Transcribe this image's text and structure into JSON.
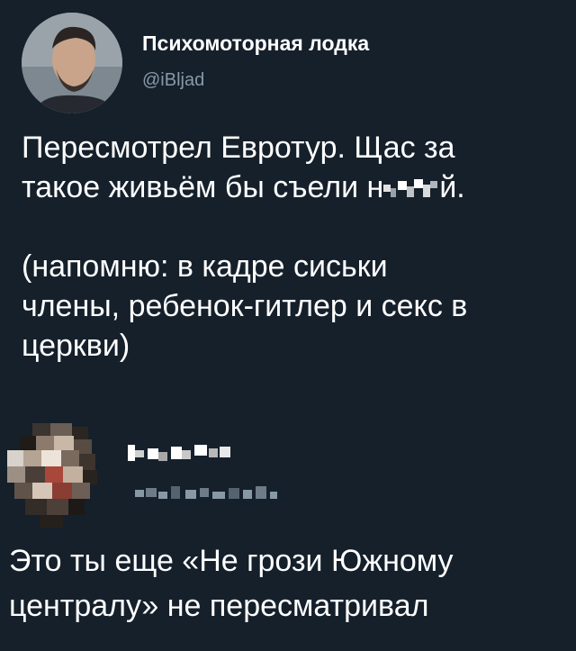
{
  "tweet": {
    "author_name": "Психомоторная лодка",
    "author_handle": "@iBljad",
    "line1": "Пересмотрел Евротур. Щас за",
    "line2_start": "такое живьём бы съели н",
    "line2_end": "й.",
    "line3": "(напомню: в кадре сиськи",
    "line4": "члены, ребенок-гитлер и секс в",
    "line5": "церкви)"
  },
  "reply": {
    "line1": "Это ты еще «Не грози Южному",
    "line2": "централу» не пересматривал"
  },
  "colors": {
    "background": "#15202b",
    "text": "#ffffff",
    "handle": "#8899a6"
  }
}
